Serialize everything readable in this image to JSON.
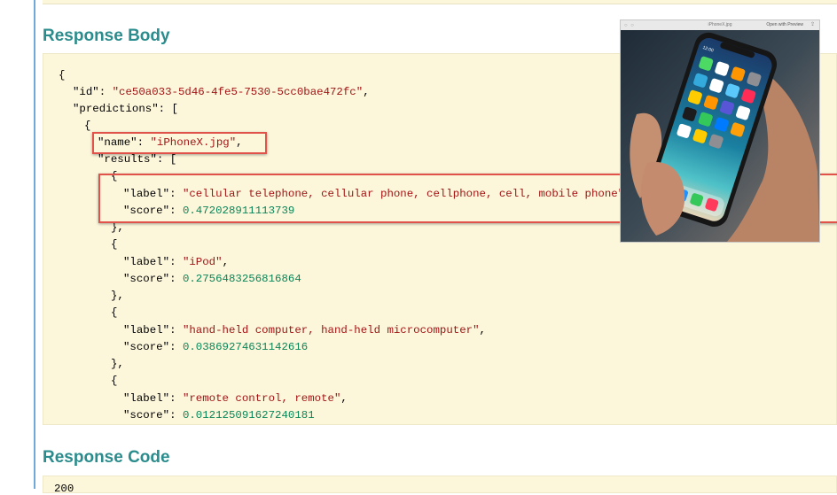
{
  "sections": {
    "response_body_title": "Response Body",
    "response_code_title": "Response Code",
    "response_code_value": "200"
  },
  "response_json": {
    "open_brace": "{",
    "id_key": "\"id\"",
    "id_value": "\"ce50a033-5d46-4fe5-7530-5cc0bae472fc\"",
    "predictions_key": "\"predictions\"",
    "prediction_open": "{",
    "name_key": "\"name\"",
    "name_value": "\"iPhoneX.jpg\"",
    "results_key": "\"results\"",
    "results": [
      {
        "label_key": "\"label\"",
        "label": "\"cellular telephone, cellular phone, cellphone, cell, mobile phone\"",
        "score_key": "\"score\"",
        "score": "0.472028911113739"
      },
      {
        "label_key": "\"label\"",
        "label": "\"iPod\"",
        "score_key": "\"score\"",
        "score": "0.2756483256816864"
      },
      {
        "label_key": "\"label\"",
        "label": "\"hand-held computer, hand-held microcomputer\"",
        "score_key": "\"score\"",
        "score": "0.03869274631142616"
      },
      {
        "label_key": "\"label\"",
        "label": "\"remote control, remote\"",
        "score_key": "\"score\"",
        "score": "0.012125091627240181"
      }
    ],
    "item_open": "{",
    "item_close": "},"
  },
  "preview_window": {
    "title": "iPhoneX.jpg",
    "open_button": "Open with Preview",
    "status_time": "12:00"
  },
  "colors": {
    "title_teal": "#2a8c8c",
    "panel_bg": "#fcf6db",
    "string_red": "#a31515",
    "number_green": "#098658",
    "highlight_red": "#e0524a",
    "left_rule_blue": "#6fa8dc"
  }
}
